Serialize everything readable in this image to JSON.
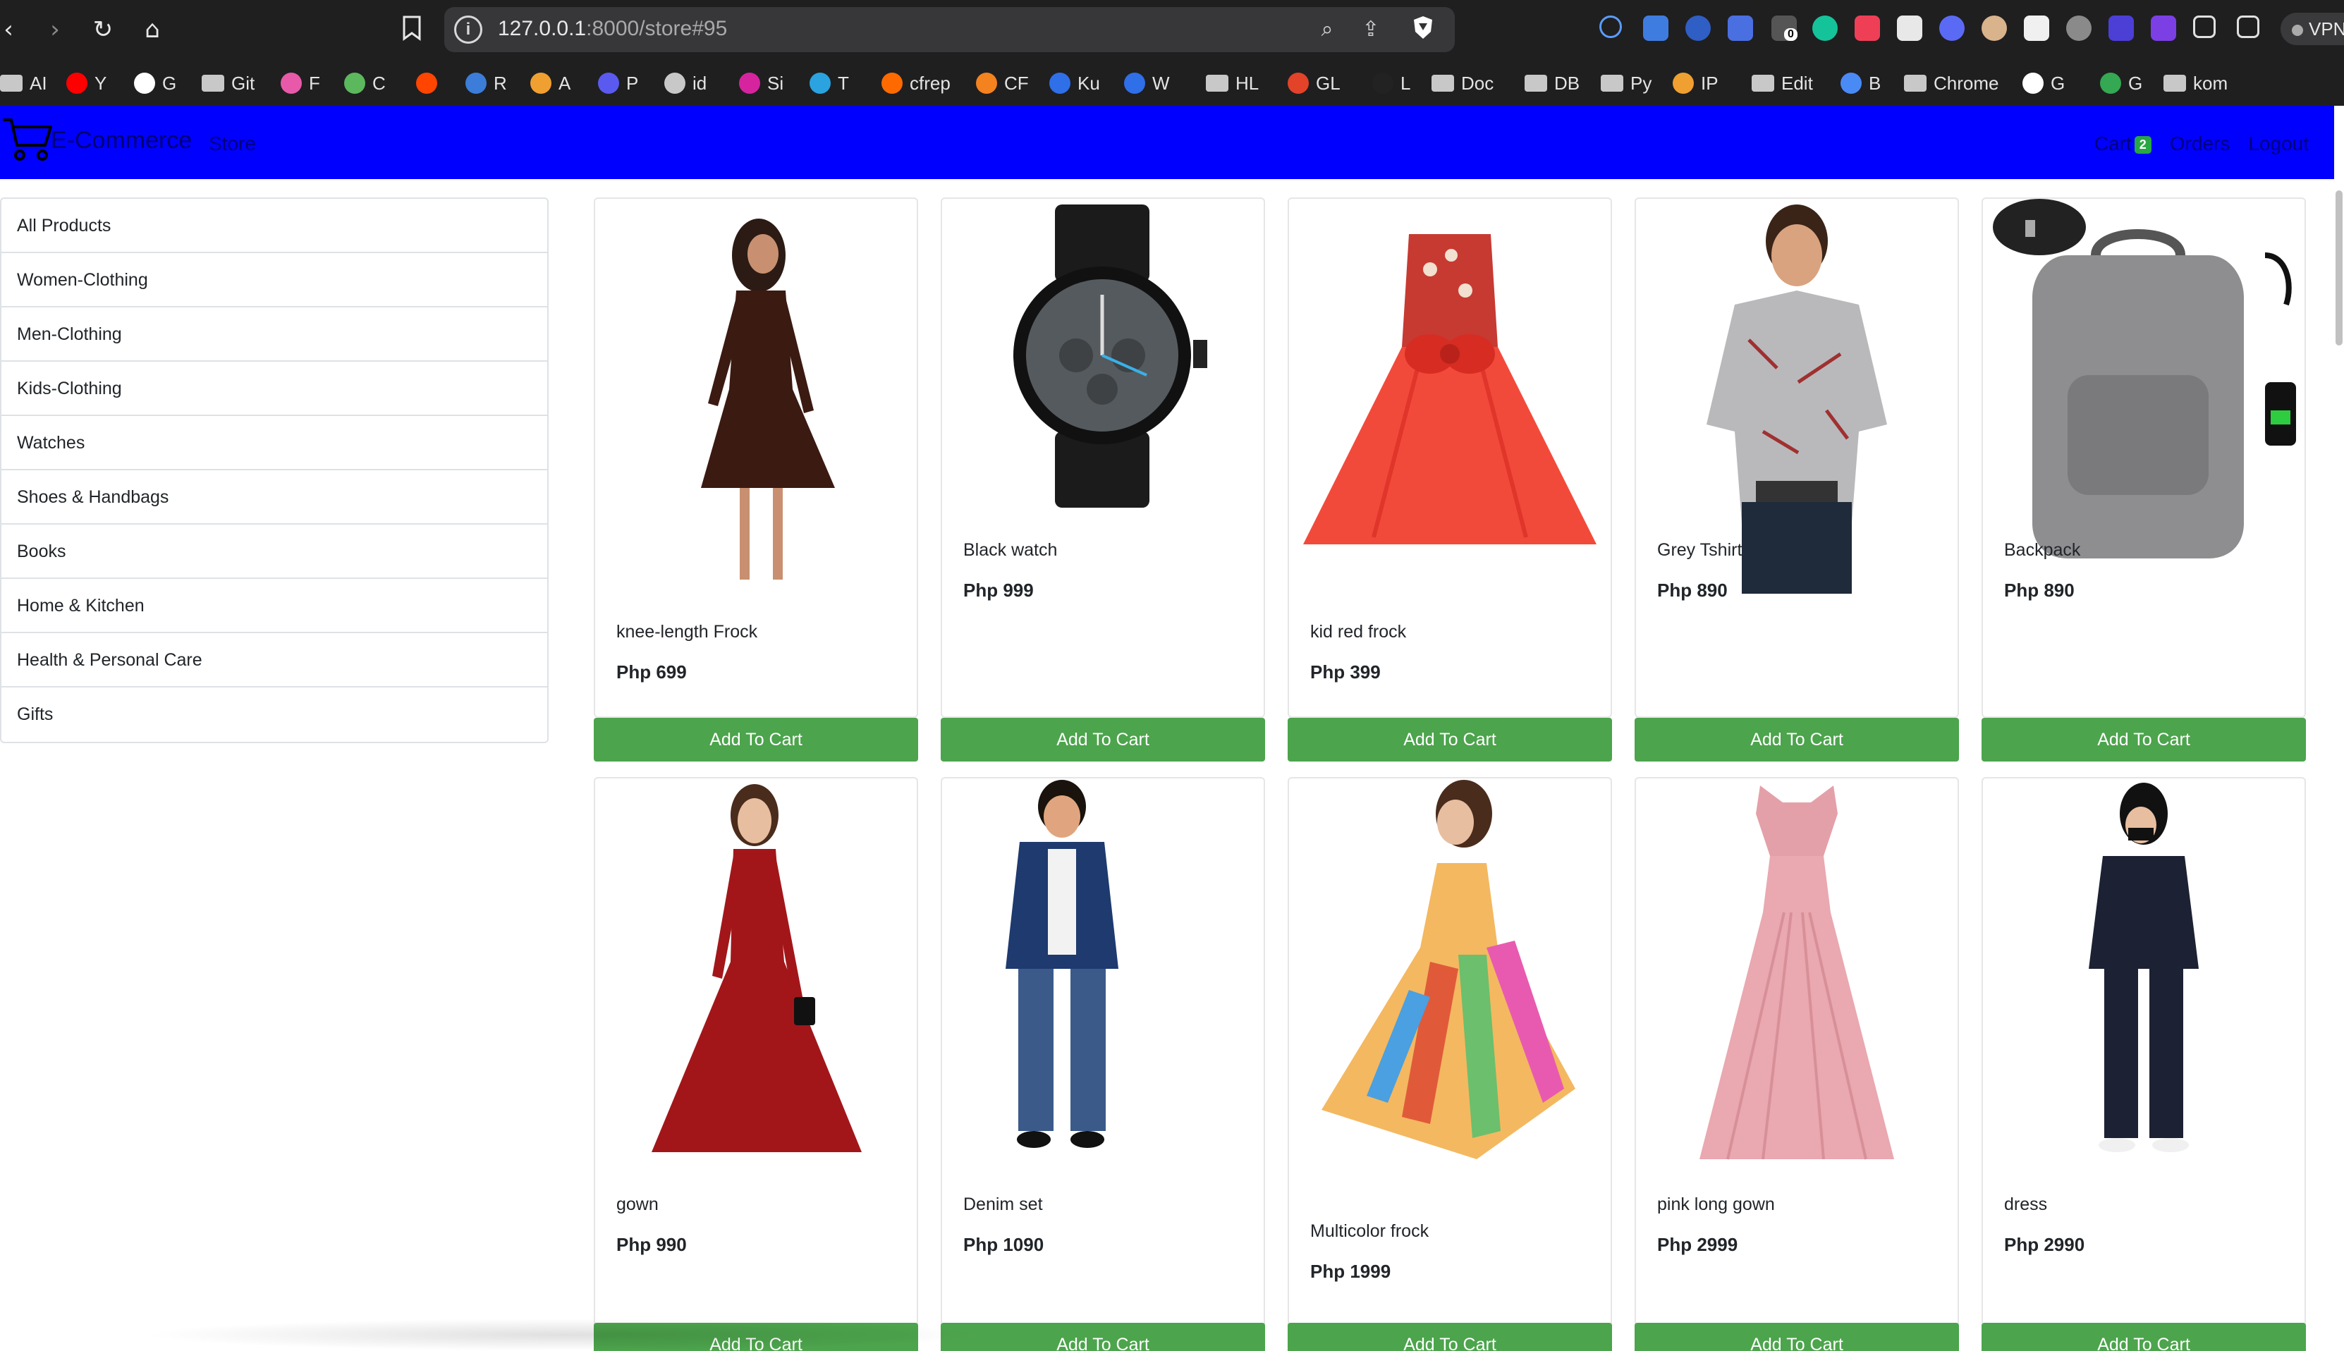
{
  "browser": {
    "url_host": "127.0.0.1",
    "url_rest": ":8000/store#95",
    "vpn_label": "VPN",
    "extension_badge": "0",
    "bookmarks": [
      {
        "label": "AI",
        "icon": "folder-icon",
        "color": "#c8c8c8"
      },
      {
        "label": "Y",
        "icon": "youtube-icon",
        "color": "#ff0000"
      },
      {
        "label": "G",
        "icon": "github-icon",
        "color": "#ffffff"
      },
      {
        "label": "Git",
        "icon": "folder-icon",
        "color": "#c8c8c8"
      },
      {
        "label": "F",
        "icon": "f-icon",
        "color": "#e85aa9"
      },
      {
        "label": "C",
        "icon": "c-icon",
        "color": "#5cb85c"
      },
      {
        "label": "",
        "icon": "reddit-icon",
        "color": "#ff4500"
      },
      {
        "label": "R",
        "icon": "r-icon",
        "color": "#3b7dd8"
      },
      {
        "label": "A",
        "icon": "a-icon",
        "color": "#f0a030"
      },
      {
        "label": "P",
        "icon": "p-icon",
        "color": "#5a5af0"
      },
      {
        "label": "id",
        "icon": "id-icon",
        "color": "#c8c8c8"
      },
      {
        "label": "Si",
        "icon": "instagram-icon",
        "color": "#d6249f"
      },
      {
        "label": "T",
        "icon": "telegram-icon",
        "color": "#2aa3e0"
      },
      {
        "label": "cfrep",
        "icon": "fire-icon",
        "color": "#ff6a00"
      },
      {
        "label": "CF",
        "icon": "cloud-icon",
        "color": "#f4821f"
      },
      {
        "label": "Ku",
        "icon": "ku-icon",
        "color": "#2f6fe8"
      },
      {
        "label": "W",
        "icon": "w-icon",
        "color": "#2f6fe8"
      },
      {
        "label": "HL",
        "icon": "folder-icon",
        "color": "#c8c8c8"
      },
      {
        "label": "GL",
        "icon": "gitlab-icon",
        "color": "#e24329"
      },
      {
        "label": "L",
        "icon": "l-icon",
        "color": "#222222"
      },
      {
        "label": "Doc",
        "icon": "folder-icon",
        "color": "#c8c8c8"
      },
      {
        "label": "DB",
        "icon": "folder-icon",
        "color": "#c8c8c8"
      },
      {
        "label": "Py",
        "icon": "folder-icon",
        "color": "#c8c8c8"
      },
      {
        "label": "IP",
        "icon": "ip-icon",
        "color": "#f0a030"
      },
      {
        "label": "Edit",
        "icon": "folder-icon",
        "color": "#c8c8c8"
      },
      {
        "label": "B",
        "icon": "sparkle-icon",
        "color": "#4a8af4"
      },
      {
        "label": "Chrome",
        "icon": "folder-icon",
        "color": "#c8c8c8"
      },
      {
        "label": "G",
        "icon": "openai-icon",
        "color": "#ffffff"
      },
      {
        "label": "G",
        "icon": "g-icon",
        "color": "#34a853"
      },
      {
        "label": "kom",
        "icon": "folder-icon",
        "color": "#c8c8c8"
      }
    ]
  },
  "navbar": {
    "brand": "E-Commerce",
    "store_link": "Store",
    "cart_label": "Cart",
    "cart_count": "2",
    "orders_link": "Orders",
    "logout_link": "Logout",
    "bg_color": "#0000ff"
  },
  "sidebar": {
    "categories": [
      "All Products",
      "Women-Clothing",
      "Men-Clothing",
      "Kids-Clothing",
      "Watches",
      "Shoes & Handbags",
      "Books",
      "Home & Kitchen",
      "Health & Personal Care",
      "Gifts"
    ]
  },
  "products": [
    {
      "name": "knee-length Frock",
      "price": "Php 699",
      "button": "Add To Cart",
      "image": "dress-icon"
    },
    {
      "name": "Black watch",
      "price": "Php 999",
      "button": "Add To Cart",
      "image": "watch-icon"
    },
    {
      "name": "kid red frock",
      "price": "Php 399",
      "button": "Add To Cart",
      "image": "dress-icon"
    },
    {
      "name": "Grey Tshirt",
      "price": "Php 890",
      "button": "Add To Cart",
      "image": "tshirt-icon"
    },
    {
      "name": "Backpack",
      "price": "Php 890",
      "button": "Add To Cart",
      "image": "backpack-icon"
    },
    {
      "name": "gown",
      "price": "Php 990",
      "button": "Add To Cart",
      "image": "dress-icon"
    },
    {
      "name": "Denim set",
      "price": "Php 1090",
      "button": "Add To Cart",
      "image": "person-icon"
    },
    {
      "name": "Multicolor frock",
      "price": "Php 1999",
      "button": "Add To Cart",
      "image": "dress-icon"
    },
    {
      "name": "pink long gown",
      "price": "Php 2999",
      "button": "Add To Cart",
      "image": "dress-icon"
    },
    {
      "name": "dress",
      "price": "Php 2990",
      "button": "Add To Cart",
      "image": "person-icon"
    }
  ],
  "colors": {
    "button_green": "#4ca44c",
    "navbar_blue": "#0000ff"
  }
}
